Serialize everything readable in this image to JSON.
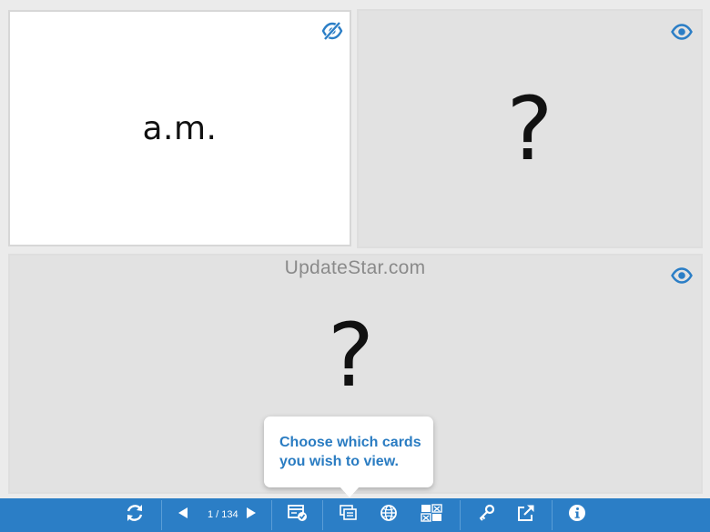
{
  "cards": {
    "top_left": {
      "text": "a.m.",
      "toggle_icon": "eye-slash-icon"
    },
    "top_right": {
      "text": "?",
      "toggle_icon": "eye-icon"
    },
    "bottom": {
      "text": "?",
      "toggle_icon": "eye-icon"
    }
  },
  "watermark": "UpdateStar.com",
  "tooltip": {
    "text": "Choose which cards you wish to view."
  },
  "toolbar": {
    "pager": {
      "label": "1 / 134"
    },
    "icons": [
      "shuffle-icon",
      "prev-icon",
      "next-icon",
      "check-cards-icon",
      "view-cards-icon",
      "globe-icon",
      "grid-toggle-icon",
      "key-icon",
      "share-icon",
      "info-icon"
    ]
  },
  "colors": {
    "accent": "#2b7ec6",
    "tooltip_text": "#2a7cc2",
    "card_hidden": "#e2e2e2",
    "card_face": "#ffffff"
  }
}
